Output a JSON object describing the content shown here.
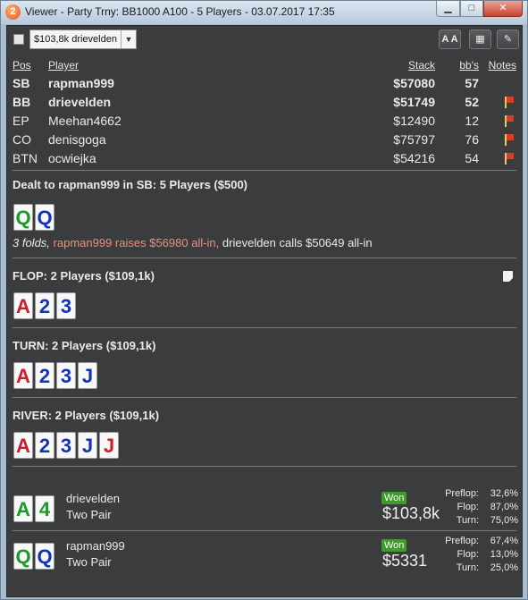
{
  "window": {
    "title": "Viewer - Party Trny: BB1000 A100 - 5 Players - 03.07.2017 17:35",
    "app_icon": "2",
    "min_icon": "minimize-icon",
    "max_icon": "maximize-icon",
    "close_icon": "close-icon"
  },
  "toolbar": {
    "hand_selector": "$103,8k drievelden",
    "aa_label": "A A"
  },
  "players_table": {
    "headers": {
      "pos": "Pos",
      "player": "Player",
      "stack": "Stack",
      "bbs": "bb's",
      "notes": "Notes"
    },
    "rows": [
      {
        "pos": "SB",
        "player": "rapman999",
        "stack": "$57080",
        "bbs": "57",
        "bold": true,
        "flag": false
      },
      {
        "pos": "BB",
        "player": "drievelden",
        "stack": "$51749",
        "bbs": "52",
        "bold": true,
        "flag": true
      },
      {
        "pos": "EP",
        "player": "Meehan4662",
        "stack": "$12490",
        "bbs": "12",
        "bold": false,
        "flag": true
      },
      {
        "pos": "CO",
        "player": "denisgoga",
        "stack": "$75797",
        "bbs": "76",
        "bold": false,
        "flag": true
      },
      {
        "pos": "BTN",
        "player": "ocwiejka",
        "stack": "$54216",
        "bbs": "54",
        "bold": false,
        "flag": true
      }
    ]
  },
  "preflop": {
    "title": "Dealt to rapman999 in SB: 5 Players ($500)",
    "cards": [
      {
        "rank": "Q",
        "suit": "green"
      },
      {
        "rank": "Q",
        "suit": "blue"
      }
    ],
    "action_folds": "3 folds,",
    "action_raise": "rapman999 raises $56980 all-in,",
    "action_call": "drievelden calls $50649 all-in"
  },
  "flop": {
    "title": "FLOP: 2 Players ($109,1k)",
    "cards": [
      {
        "rank": "A",
        "suit": "red"
      },
      {
        "rank": "2",
        "suit": "blue"
      },
      {
        "rank": "3",
        "suit": "blue"
      }
    ]
  },
  "turn": {
    "title": "TURN: 2 Players ($109,1k)",
    "cards": [
      {
        "rank": "A",
        "suit": "red"
      },
      {
        "rank": "2",
        "suit": "blue"
      },
      {
        "rank": "3",
        "suit": "blue"
      },
      {
        "rank": "J",
        "suit": "blue"
      }
    ]
  },
  "river": {
    "title": "RIVER: 2 Players ($109,1k)",
    "cards": [
      {
        "rank": "A",
        "suit": "red"
      },
      {
        "rank": "2",
        "suit": "blue"
      },
      {
        "rank": "3",
        "suit": "blue"
      },
      {
        "rank": "J",
        "suit": "blue"
      },
      {
        "rank": "J",
        "suit": "red"
      }
    ]
  },
  "results": [
    {
      "name": "drievelden",
      "hand": "Two Pair",
      "won_label": "Won",
      "amount": "$103,8k",
      "cards": [
        {
          "rank": "A",
          "suit": "green"
        },
        {
          "rank": "4",
          "suit": "green"
        }
      ],
      "stats": [
        {
          "label": "Preflop:",
          "value": "32,6%"
        },
        {
          "label": "Flop:",
          "value": "87,0%"
        },
        {
          "label": "Turn:",
          "value": "75,0%"
        }
      ]
    },
    {
      "name": "rapman999",
      "hand": "Two Pair",
      "won_label": "Won",
      "amount": "$5331",
      "cards": [
        {
          "rank": "Q",
          "suit": "green"
        },
        {
          "rank": "Q",
          "suit": "blue"
        }
      ],
      "stats": [
        {
          "label": "Preflop:",
          "value": "67,4%"
        },
        {
          "label": "Flop:",
          "value": "13,0%"
        },
        {
          "label": "Turn:",
          "value": "25,0%"
        }
      ]
    }
  ],
  "colors": {
    "red": "#d21a2a",
    "blue": "#1232b8",
    "green": "#1a9a2a",
    "won": "#3f9b2b",
    "raise_text": "#ef8d80"
  }
}
